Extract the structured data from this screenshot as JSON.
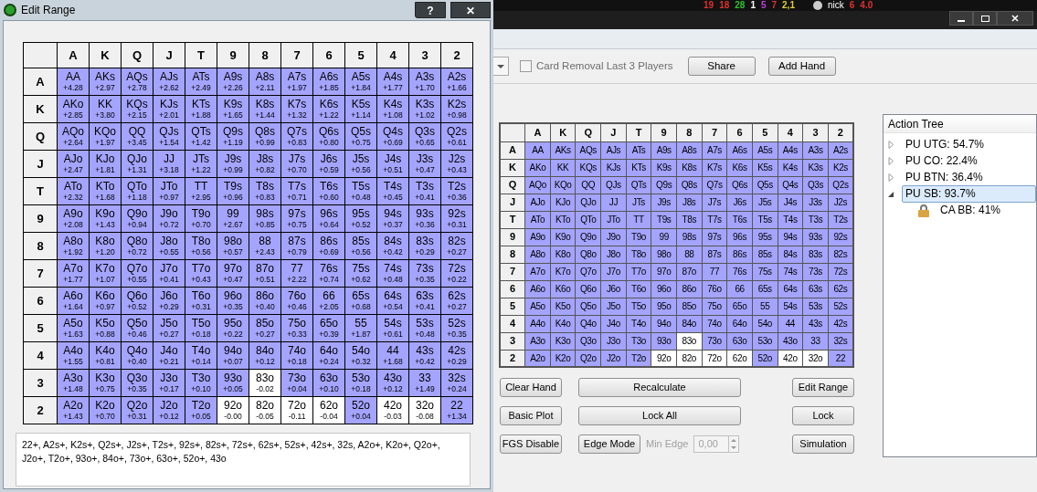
{
  "edit_range_window": {
    "title": "Edit Range",
    "help_button": "?",
    "close_button": "✕",
    "columns": [
      "A",
      "K",
      "Q",
      "J",
      "T",
      "9",
      "8",
      "7",
      "6",
      "5",
      "4",
      "3",
      "2"
    ],
    "rows": [
      {
        "label": "A",
        "cells": [
          {
            "hand": "AA",
            "ev": "+4.28",
            "selected": true
          },
          {
            "hand": "AKs",
            "ev": "+2.97",
            "selected": true
          },
          {
            "hand": "AQs",
            "ev": "+2.78",
            "selected": true
          },
          {
            "hand": "AJs",
            "ev": "+2.62",
            "selected": true
          },
          {
            "hand": "ATs",
            "ev": "+2.49",
            "selected": true
          },
          {
            "hand": "A9s",
            "ev": "+2.26",
            "selected": true
          },
          {
            "hand": "A8s",
            "ev": "+2.11",
            "selected": true
          },
          {
            "hand": "A7s",
            "ev": "+1.97",
            "selected": true
          },
          {
            "hand": "A6s",
            "ev": "+1.85",
            "selected": true
          },
          {
            "hand": "A5s",
            "ev": "+1.84",
            "selected": true
          },
          {
            "hand": "A4s",
            "ev": "+1.77",
            "selected": true
          },
          {
            "hand": "A3s",
            "ev": "+1.70",
            "selected": true
          },
          {
            "hand": "A2s",
            "ev": "+1.66",
            "selected": true
          }
        ]
      },
      {
        "label": "K",
        "cells": [
          {
            "hand": "AKo",
            "ev": "+2.85",
            "selected": true
          },
          {
            "hand": "KK",
            "ev": "+3.80",
            "selected": true
          },
          {
            "hand": "KQs",
            "ev": "+2.15",
            "selected": true
          },
          {
            "hand": "KJs",
            "ev": "+2.01",
            "selected": true
          },
          {
            "hand": "KTs",
            "ev": "+1.88",
            "selected": true
          },
          {
            "hand": "K9s",
            "ev": "+1.65",
            "selected": true
          },
          {
            "hand": "K8s",
            "ev": "+1.44",
            "selected": true
          },
          {
            "hand": "K7s",
            "ev": "+1.32",
            "selected": true
          },
          {
            "hand": "K6s",
            "ev": "+1.22",
            "selected": true
          },
          {
            "hand": "K5s",
            "ev": "+1.14",
            "selected": true
          },
          {
            "hand": "K4s",
            "ev": "+1.08",
            "selected": true
          },
          {
            "hand": "K3s",
            "ev": "+1.02",
            "selected": true
          },
          {
            "hand": "K2s",
            "ev": "+0.98",
            "selected": true
          }
        ]
      },
      {
        "label": "Q",
        "cells": [
          {
            "hand": "AQo",
            "ev": "+2.64",
            "selected": true
          },
          {
            "hand": "KQo",
            "ev": "+1.97",
            "selected": true
          },
          {
            "hand": "QQ",
            "ev": "+3.45",
            "selected": true
          },
          {
            "hand": "QJs",
            "ev": "+1.54",
            "selected": true
          },
          {
            "hand": "QTs",
            "ev": "+1.42",
            "selected": true
          },
          {
            "hand": "Q9s",
            "ev": "+1.19",
            "selected": true
          },
          {
            "hand": "Q8s",
            "ev": "+0.99",
            "selected": true
          },
          {
            "hand": "Q7s",
            "ev": "+0.83",
            "selected": true
          },
          {
            "hand": "Q6s",
            "ev": "+0.80",
            "selected": true
          },
          {
            "hand": "Q5s",
            "ev": "+0.75",
            "selected": true
          },
          {
            "hand": "Q4s",
            "ev": "+0.69",
            "selected": true
          },
          {
            "hand": "Q3s",
            "ev": "+0.65",
            "selected": true
          },
          {
            "hand": "Q2s",
            "ev": "+0.61",
            "selected": true
          }
        ]
      },
      {
        "label": "J",
        "cells": [
          {
            "hand": "AJo",
            "ev": "+2.47",
            "selected": true
          },
          {
            "hand": "KJo",
            "ev": "+1.81",
            "selected": true
          },
          {
            "hand": "QJo",
            "ev": "+1.31",
            "selected": true
          },
          {
            "hand": "JJ",
            "ev": "+3.18",
            "selected": true
          },
          {
            "hand": "JTs",
            "ev": "+1.22",
            "selected": true
          },
          {
            "hand": "J9s",
            "ev": "+0.99",
            "selected": true
          },
          {
            "hand": "J8s",
            "ev": "+0.82",
            "selected": true
          },
          {
            "hand": "J7s",
            "ev": "+0.70",
            "selected": true
          },
          {
            "hand": "J6s",
            "ev": "+0.59",
            "selected": true
          },
          {
            "hand": "J5s",
            "ev": "+0.56",
            "selected": true
          },
          {
            "hand": "J4s",
            "ev": "+0.51",
            "selected": true
          },
          {
            "hand": "J3s",
            "ev": "+0.47",
            "selected": true
          },
          {
            "hand": "J2s",
            "ev": "+0.43",
            "selected": true
          }
        ]
      },
      {
        "label": "T",
        "cells": [
          {
            "hand": "ATo",
            "ev": "+2.32",
            "selected": true
          },
          {
            "hand": "KTo",
            "ev": "+1.68",
            "selected": true
          },
          {
            "hand": "QTo",
            "ev": "+1.18",
            "selected": true
          },
          {
            "hand": "JTo",
            "ev": "+0.97",
            "selected": true
          },
          {
            "hand": "TT",
            "ev": "+2.95",
            "selected": true
          },
          {
            "hand": "T9s",
            "ev": "+0.96",
            "selected": true
          },
          {
            "hand": "T8s",
            "ev": "+0.83",
            "selected": true
          },
          {
            "hand": "T7s",
            "ev": "+0.71",
            "selected": true
          },
          {
            "hand": "T6s",
            "ev": "+0.60",
            "selected": true
          },
          {
            "hand": "T5s",
            "ev": "+0.48",
            "selected": true
          },
          {
            "hand": "T4s",
            "ev": "+0.45",
            "selected": true
          },
          {
            "hand": "T3s",
            "ev": "+0.41",
            "selected": true
          },
          {
            "hand": "T2s",
            "ev": "+0.36",
            "selected": true
          }
        ]
      },
      {
        "label": "9",
        "cells": [
          {
            "hand": "A9o",
            "ev": "+2.08",
            "selected": true
          },
          {
            "hand": "K9o",
            "ev": "+1.43",
            "selected": true
          },
          {
            "hand": "Q9o",
            "ev": "+0.94",
            "selected": true
          },
          {
            "hand": "J9o",
            "ev": "+0.72",
            "selected": true
          },
          {
            "hand": "T9o",
            "ev": "+0.70",
            "selected": true
          },
          {
            "hand": "99",
            "ev": "+2.67",
            "selected": true
          },
          {
            "hand": "98s",
            "ev": "+0.85",
            "selected": true
          },
          {
            "hand": "97s",
            "ev": "+0.75",
            "selected": true
          },
          {
            "hand": "96s",
            "ev": "+0.64",
            "selected": true
          },
          {
            "hand": "95s",
            "ev": "+0.52",
            "selected": true
          },
          {
            "hand": "94s",
            "ev": "+0.37",
            "selected": true
          },
          {
            "hand": "93s",
            "ev": "+0.36",
            "selected": true
          },
          {
            "hand": "92s",
            "ev": "+0.31",
            "selected": true
          }
        ]
      },
      {
        "label": "8",
        "cells": [
          {
            "hand": "A8o",
            "ev": "+1.92",
            "selected": true
          },
          {
            "hand": "K8o",
            "ev": "+1.20",
            "selected": true
          },
          {
            "hand": "Q8o",
            "ev": "+0.72",
            "selected": true
          },
          {
            "hand": "J8o",
            "ev": "+0.55",
            "selected": true
          },
          {
            "hand": "T8o",
            "ev": "+0.56",
            "selected": true
          },
          {
            "hand": "98o",
            "ev": "+0.57",
            "selected": true
          },
          {
            "hand": "88",
            "ev": "+2.43",
            "selected": true
          },
          {
            "hand": "87s",
            "ev": "+0.79",
            "selected": true
          },
          {
            "hand": "86s",
            "ev": "+0.69",
            "selected": true
          },
          {
            "hand": "85s",
            "ev": "+0.56",
            "selected": true
          },
          {
            "hand": "84s",
            "ev": "+0.42",
            "selected": true
          },
          {
            "hand": "83s",
            "ev": "+0.29",
            "selected": true
          },
          {
            "hand": "82s",
            "ev": "+0.27",
            "selected": true
          }
        ]
      },
      {
        "label": "7",
        "cells": [
          {
            "hand": "A7o",
            "ev": "+1.77",
            "selected": true
          },
          {
            "hand": "K7o",
            "ev": "+1.07",
            "selected": true
          },
          {
            "hand": "Q7o",
            "ev": "+0.55",
            "selected": true
          },
          {
            "hand": "J7o",
            "ev": "+0.41",
            "selected": true
          },
          {
            "hand": "T7o",
            "ev": "+0.43",
            "selected": true
          },
          {
            "hand": "97o",
            "ev": "+0.47",
            "selected": true
          },
          {
            "hand": "87o",
            "ev": "+0.51",
            "selected": true
          },
          {
            "hand": "77",
            "ev": "+2.22",
            "selected": true
          },
          {
            "hand": "76s",
            "ev": "+0.74",
            "selected": true
          },
          {
            "hand": "75s",
            "ev": "+0.62",
            "selected": true
          },
          {
            "hand": "74s",
            "ev": "+0.48",
            "selected": true
          },
          {
            "hand": "73s",
            "ev": "+0.35",
            "selected": true
          },
          {
            "hand": "72s",
            "ev": "+0.22",
            "selected": true
          }
        ]
      },
      {
        "label": "6",
        "cells": [
          {
            "hand": "A6o",
            "ev": "+1.64",
            "selected": true
          },
          {
            "hand": "K6o",
            "ev": "+0.97",
            "selected": true
          },
          {
            "hand": "Q6o",
            "ev": "+0.52",
            "selected": true
          },
          {
            "hand": "J6o",
            "ev": "+0.29",
            "selected": true
          },
          {
            "hand": "T6o",
            "ev": "+0.31",
            "selected": true
          },
          {
            "hand": "96o",
            "ev": "+0.35",
            "selected": true
          },
          {
            "hand": "86o",
            "ev": "+0.40",
            "selected": true
          },
          {
            "hand": "76o",
            "ev": "+0.46",
            "selected": true
          },
          {
            "hand": "66",
            "ev": "+2.05",
            "selected": true
          },
          {
            "hand": "65s",
            "ev": "+0.68",
            "selected": true
          },
          {
            "hand": "64s",
            "ev": "+0.54",
            "selected": true
          },
          {
            "hand": "63s",
            "ev": "+0.41",
            "selected": true
          },
          {
            "hand": "62s",
            "ev": "+0.27",
            "selected": true
          }
        ]
      },
      {
        "label": "5",
        "cells": [
          {
            "hand": "A5o",
            "ev": "+1.63",
            "selected": true
          },
          {
            "hand": "K5o",
            "ev": "+0.88",
            "selected": true
          },
          {
            "hand": "Q5o",
            "ev": "+0.46",
            "selected": true
          },
          {
            "hand": "J5o",
            "ev": "+0.27",
            "selected": true
          },
          {
            "hand": "T5o",
            "ev": "+0.18",
            "selected": true
          },
          {
            "hand": "95o",
            "ev": "+0.22",
            "selected": true
          },
          {
            "hand": "85o",
            "ev": "+0.27",
            "selected": true
          },
          {
            "hand": "75o",
            "ev": "+0.33",
            "selected": true
          },
          {
            "hand": "65o",
            "ev": "+0.39",
            "selected": true
          },
          {
            "hand": "55",
            "ev": "+1.87",
            "selected": true
          },
          {
            "hand": "54s",
            "ev": "+0.61",
            "selected": true
          },
          {
            "hand": "53s",
            "ev": "+0.48",
            "selected": true
          },
          {
            "hand": "52s",
            "ev": "+0.35",
            "selected": true
          }
        ]
      },
      {
        "label": "4",
        "cells": [
          {
            "hand": "A4o",
            "ev": "+1.55",
            "selected": true
          },
          {
            "hand": "K4o",
            "ev": "+0.81",
            "selected": true
          },
          {
            "hand": "Q4o",
            "ev": "+0.40",
            "selected": true
          },
          {
            "hand": "J4o",
            "ev": "+0.21",
            "selected": true
          },
          {
            "hand": "T4o",
            "ev": "+0.14",
            "selected": true
          },
          {
            "hand": "94o",
            "ev": "+0.07",
            "selected": true
          },
          {
            "hand": "84o",
            "ev": "+0.12",
            "selected": true
          },
          {
            "hand": "74o",
            "ev": "+0.18",
            "selected": true
          },
          {
            "hand": "64o",
            "ev": "+0.24",
            "selected": true
          },
          {
            "hand": "54o",
            "ev": "+0.32",
            "selected": true
          },
          {
            "hand": "44",
            "ev": "+1.68",
            "selected": true
          },
          {
            "hand": "43s",
            "ev": "+0.42",
            "selected": true
          },
          {
            "hand": "42s",
            "ev": "+0.29",
            "selected": true
          }
        ]
      },
      {
        "label": "3",
        "cells": [
          {
            "hand": "A3o",
            "ev": "+1.48",
            "selected": true
          },
          {
            "hand": "K3o",
            "ev": "+0.75",
            "selected": true
          },
          {
            "hand": "Q3o",
            "ev": "+0.35",
            "selected": true
          },
          {
            "hand": "J3o",
            "ev": "+0.17",
            "selected": true
          },
          {
            "hand": "T3o",
            "ev": "+0.10",
            "selected": true
          },
          {
            "hand": "93o",
            "ev": "+0.05",
            "selected": true
          },
          {
            "hand": "83o",
            "ev": "-0.02",
            "selected": false
          },
          {
            "hand": "73o",
            "ev": "+0.04",
            "selected": true
          },
          {
            "hand": "63o",
            "ev": "+0.10",
            "selected": true
          },
          {
            "hand": "53o",
            "ev": "+0.18",
            "selected": true
          },
          {
            "hand": "43o",
            "ev": "+0.12",
            "selected": true
          },
          {
            "hand": "33",
            "ev": "+1.49",
            "selected": true
          },
          {
            "hand": "32s",
            "ev": "+0.24",
            "selected": true
          }
        ]
      },
      {
        "label": "2",
        "cells": [
          {
            "hand": "A2o",
            "ev": "+1.43",
            "selected": true
          },
          {
            "hand": "K2o",
            "ev": "+0.70",
            "selected": true
          },
          {
            "hand": "Q2o",
            "ev": "+0.31",
            "selected": true
          },
          {
            "hand": "J2o",
            "ev": "+0.12",
            "selected": true
          },
          {
            "hand": "T2o",
            "ev": "+0.05",
            "selected": true
          },
          {
            "hand": "92o",
            "ev": "-0.00",
            "selected": false
          },
          {
            "hand": "82o",
            "ev": "-0.05",
            "selected": false
          },
          {
            "hand": "72o",
            "ev": "-0.11",
            "selected": false
          },
          {
            "hand": "62o",
            "ev": "-0.04",
            "selected": false
          },
          {
            "hand": "52o",
            "ev": "+0.04",
            "selected": true
          },
          {
            "hand": "42o",
            "ev": "-0.03",
            "selected": false
          },
          {
            "hand": "32o",
            "ev": "-0.08",
            "selected": false
          },
          {
            "hand": "22",
            "ev": "+1.34",
            "selected": true
          }
        ]
      }
    ],
    "range_text": "22+, A2s+, K2s+, Q2s+, J2s+, T2s+, 92s+, 82s+, 72s+, 62s+, 52s+, 42s+, 32s, A2o+, K2o+, Q2o+, J2o+, T2o+, 93o+, 84o+, 73o+, 63o+, 52o+, 43o"
  },
  "background_window": {
    "stats": [
      {
        "text": "19",
        "color": "#e03030"
      },
      {
        "text": "18",
        "color": "#e03030"
      },
      {
        "text": "28",
        "color": "#30c030"
      },
      {
        "text": "1",
        "color": "#ffffff"
      },
      {
        "text": "5",
        "color": "#c040e0"
      },
      {
        "text": "7",
        "color": "#e03030"
      },
      {
        "text": "2,1",
        "color": "#e0d030"
      }
    ],
    "player": "nick",
    "player_stats": [
      "6",
      "4.0"
    ]
  },
  "main_window": {
    "toolbar": {
      "card_removal": {
        "label": "Card Removal Last 3 Players",
        "checked": false
      },
      "share": "Share",
      "add_hand": "Add Hand"
    },
    "columns": [
      "A",
      "K",
      "Q",
      "J",
      "T",
      "9",
      "8",
      "7",
      "6",
      "5",
      "4",
      "3",
      "2"
    ],
    "rows": [
      {
        "label": "A",
        "cells": [
          {
            "hand": "AA",
            "selected": true
          },
          {
            "hand": "AKs",
            "selected": true
          },
          {
            "hand": "AQs",
            "selected": true
          },
          {
            "hand": "AJs",
            "selected": true
          },
          {
            "hand": "ATs",
            "selected": true
          },
          {
            "hand": "A9s",
            "selected": true
          },
          {
            "hand": "A8s",
            "selected": true
          },
          {
            "hand": "A7s",
            "selected": true
          },
          {
            "hand": "A6s",
            "selected": true
          },
          {
            "hand": "A5s",
            "selected": true
          },
          {
            "hand": "A4s",
            "selected": true
          },
          {
            "hand": "A3s",
            "selected": true
          },
          {
            "hand": "A2s",
            "selected": true
          }
        ]
      },
      {
        "label": "K",
        "cells": [
          {
            "hand": "AKo",
            "selected": true
          },
          {
            "hand": "KK",
            "selected": true
          },
          {
            "hand": "KQs",
            "selected": true
          },
          {
            "hand": "KJs",
            "selected": true
          },
          {
            "hand": "KTs",
            "selected": true
          },
          {
            "hand": "K9s",
            "selected": true
          },
          {
            "hand": "K8s",
            "selected": true
          },
          {
            "hand": "K7s",
            "selected": true
          },
          {
            "hand": "K6s",
            "selected": true
          },
          {
            "hand": "K5s",
            "selected": true
          },
          {
            "hand": "K4s",
            "selected": true
          },
          {
            "hand": "K3s",
            "selected": true
          },
          {
            "hand": "K2s",
            "selected": true
          }
        ]
      },
      {
        "label": "Q",
        "cells": [
          {
            "hand": "AQo",
            "selected": true
          },
          {
            "hand": "KQo",
            "selected": true
          },
          {
            "hand": "QQ",
            "selected": true
          },
          {
            "hand": "QJs",
            "selected": true
          },
          {
            "hand": "QTs",
            "selected": true
          },
          {
            "hand": "Q9s",
            "selected": true
          },
          {
            "hand": "Q8s",
            "selected": true
          },
          {
            "hand": "Q7s",
            "selected": true
          },
          {
            "hand": "Q6s",
            "selected": true
          },
          {
            "hand": "Q5s",
            "selected": true
          },
          {
            "hand": "Q4s",
            "selected": true
          },
          {
            "hand": "Q3s",
            "selected": true
          },
          {
            "hand": "Q2s",
            "selected": true
          }
        ]
      },
      {
        "label": "J",
        "cells": [
          {
            "hand": "AJo",
            "selected": true
          },
          {
            "hand": "KJo",
            "selected": true
          },
          {
            "hand": "QJo",
            "selected": true
          },
          {
            "hand": "JJ",
            "selected": true
          },
          {
            "hand": "JTs",
            "selected": true
          },
          {
            "hand": "J9s",
            "selected": true
          },
          {
            "hand": "J8s",
            "selected": true
          },
          {
            "hand": "J7s",
            "selected": true
          },
          {
            "hand": "J6s",
            "selected": true
          },
          {
            "hand": "J5s",
            "selected": true
          },
          {
            "hand": "J4s",
            "selected": true
          },
          {
            "hand": "J3s",
            "selected": true
          },
          {
            "hand": "J2s",
            "selected": true
          }
        ]
      },
      {
        "label": "T",
        "cells": [
          {
            "hand": "ATo",
            "selected": true
          },
          {
            "hand": "KTo",
            "selected": true
          },
          {
            "hand": "QTo",
            "selected": true
          },
          {
            "hand": "JTo",
            "selected": true
          },
          {
            "hand": "TT",
            "selected": true
          },
          {
            "hand": "T9s",
            "selected": true
          },
          {
            "hand": "T8s",
            "selected": true
          },
          {
            "hand": "T7s",
            "selected": true
          },
          {
            "hand": "T6s",
            "selected": true
          },
          {
            "hand": "T5s",
            "selected": true
          },
          {
            "hand": "T4s",
            "selected": true
          },
          {
            "hand": "T3s",
            "selected": true
          },
          {
            "hand": "T2s",
            "selected": true
          }
        ]
      },
      {
        "label": "9",
        "cells": [
          {
            "hand": "A9o",
            "selected": true
          },
          {
            "hand": "K9o",
            "selected": true
          },
          {
            "hand": "Q9o",
            "selected": true
          },
          {
            "hand": "J9o",
            "selected": true
          },
          {
            "hand": "T9o",
            "selected": true
          },
          {
            "hand": "99",
            "selected": true
          },
          {
            "hand": "98s",
            "selected": true
          },
          {
            "hand": "97s",
            "selected": true
          },
          {
            "hand": "96s",
            "selected": true
          },
          {
            "hand": "95s",
            "selected": true
          },
          {
            "hand": "94s",
            "selected": true
          },
          {
            "hand": "93s",
            "selected": true
          },
          {
            "hand": "92s",
            "selected": true
          }
        ]
      },
      {
        "label": "8",
        "cells": [
          {
            "hand": "A8o",
            "selected": true
          },
          {
            "hand": "K8o",
            "selected": true
          },
          {
            "hand": "Q8o",
            "selected": true
          },
          {
            "hand": "J8o",
            "selected": true
          },
          {
            "hand": "T8o",
            "selected": true
          },
          {
            "hand": "98o",
            "selected": true
          },
          {
            "hand": "88",
            "selected": true
          },
          {
            "hand": "87s",
            "selected": true
          },
          {
            "hand": "86s",
            "selected": true
          },
          {
            "hand": "85s",
            "selected": true
          },
          {
            "hand": "84s",
            "selected": true
          },
          {
            "hand": "83s",
            "selected": true
          },
          {
            "hand": "82s",
            "selected": true
          }
        ]
      },
      {
        "label": "7",
        "cells": [
          {
            "hand": "A7o",
            "selected": true
          },
          {
            "hand": "K7o",
            "selected": true
          },
          {
            "hand": "Q7o",
            "selected": true
          },
          {
            "hand": "J7o",
            "selected": true
          },
          {
            "hand": "T7o",
            "selected": true
          },
          {
            "hand": "97o",
            "selected": true
          },
          {
            "hand": "87o",
            "selected": true
          },
          {
            "hand": "77",
            "selected": true
          },
          {
            "hand": "76s",
            "selected": true
          },
          {
            "hand": "75s",
            "selected": true
          },
          {
            "hand": "74s",
            "selected": true
          },
          {
            "hand": "73s",
            "selected": true
          },
          {
            "hand": "72s",
            "selected": true
          }
        ]
      },
      {
        "label": "6",
        "cells": [
          {
            "hand": "A6o",
            "selected": true
          },
          {
            "hand": "K6o",
            "selected": true
          },
          {
            "hand": "Q6o",
            "selected": true
          },
          {
            "hand": "J6o",
            "selected": true
          },
          {
            "hand": "T6o",
            "selected": true
          },
          {
            "hand": "96o",
            "selected": true
          },
          {
            "hand": "86o",
            "selected": true
          },
          {
            "hand": "76o",
            "selected": true
          },
          {
            "hand": "66",
            "selected": true
          },
          {
            "hand": "65s",
            "selected": true
          },
          {
            "hand": "64s",
            "selected": true
          },
          {
            "hand": "63s",
            "selected": true
          },
          {
            "hand": "62s",
            "selected": true
          }
        ]
      },
      {
        "label": "5",
        "cells": [
          {
            "hand": "A5o",
            "selected": true
          },
          {
            "hand": "K5o",
            "selected": true
          },
          {
            "hand": "Q5o",
            "selected": true
          },
          {
            "hand": "J5o",
            "selected": true
          },
          {
            "hand": "T5o",
            "selected": true
          },
          {
            "hand": "95o",
            "selected": true
          },
          {
            "hand": "85o",
            "selected": true
          },
          {
            "hand": "75o",
            "selected": true
          },
          {
            "hand": "65o",
            "selected": true
          },
          {
            "hand": "55",
            "selected": true
          },
          {
            "hand": "54s",
            "selected": true
          },
          {
            "hand": "53s",
            "selected": true
          },
          {
            "hand": "52s",
            "selected": true
          }
        ]
      },
      {
        "label": "4",
        "cells": [
          {
            "hand": "A4o",
            "selected": true
          },
          {
            "hand": "K4o",
            "selected": true
          },
          {
            "hand": "Q4o",
            "selected": true
          },
          {
            "hand": "J4o",
            "selected": true
          },
          {
            "hand": "T4o",
            "selected": true
          },
          {
            "hand": "94o",
            "selected": true
          },
          {
            "hand": "84o",
            "selected": true
          },
          {
            "hand": "74o",
            "selected": true
          },
          {
            "hand": "64o",
            "selected": true
          },
          {
            "hand": "54o",
            "selected": true
          },
          {
            "hand": "44",
            "selected": true
          },
          {
            "hand": "43s",
            "selected": true
          },
          {
            "hand": "42s",
            "selected": true
          }
        ]
      },
      {
        "label": "3",
        "cells": [
          {
            "hand": "A3o",
            "selected": true
          },
          {
            "hand": "K3o",
            "selected": true
          },
          {
            "hand": "Q3o",
            "selected": true
          },
          {
            "hand": "J3o",
            "selected": true
          },
          {
            "hand": "T3o",
            "selected": true
          },
          {
            "hand": "93o",
            "selected": true
          },
          {
            "hand": "83o",
            "selected": false
          },
          {
            "hand": "73o",
            "selected": true
          },
          {
            "hand": "63o",
            "selected": true
          },
          {
            "hand": "53o",
            "selected": true
          },
          {
            "hand": "43o",
            "selected": true
          },
          {
            "hand": "33",
            "selected": true
          },
          {
            "hand": "32s",
            "selected": true
          }
        ]
      },
      {
        "label": "2",
        "cells": [
          {
            "hand": "A2o",
            "selected": true
          },
          {
            "hand": "K2o",
            "selected": true
          },
          {
            "hand": "Q2o",
            "selected": true
          },
          {
            "hand": "J2o",
            "selected": true
          },
          {
            "hand": "T2o",
            "selected": true
          },
          {
            "hand": "92o",
            "selected": false
          },
          {
            "hand": "82o",
            "selected": false
          },
          {
            "hand": "72o",
            "selected": false
          },
          {
            "hand": "62o",
            "selected": false
          },
          {
            "hand": "52o",
            "selected": true
          },
          {
            "hand": "42o",
            "selected": false
          },
          {
            "hand": "32o",
            "selected": false
          },
          {
            "hand": "22",
            "selected": true
          }
        ]
      }
    ],
    "buttons": {
      "clear_hand": "Clear Hand",
      "recalculate": "Recalculate",
      "edit_range": "Edit Range",
      "basic_plot": "Basic Plot",
      "lock_all": "Lock All",
      "lock": "Lock",
      "fgs_disable": "FGS Disable",
      "edge_mode": "Edge Mode",
      "simulation": "Simulation"
    },
    "min_edge": {
      "label": "Min Edge",
      "value": "0,00",
      "disabled": true
    },
    "action_tree": {
      "title": "Action Tree",
      "items": [
        {
          "label": "PU UTG: 54.7%",
          "expanded": false,
          "selected": false
        },
        {
          "label": "PU CO: 22.4%",
          "expanded": false,
          "selected": false
        },
        {
          "label": "PU BTN: 36.4%",
          "expanded": false,
          "selected": false
        },
        {
          "label": "PU SB: 93.7%",
          "expanded": true,
          "selected": true,
          "children": [
            {
              "label": "CA BB: 41%",
              "locked": true,
              "selected": false
            }
          ]
        }
      ]
    }
  }
}
